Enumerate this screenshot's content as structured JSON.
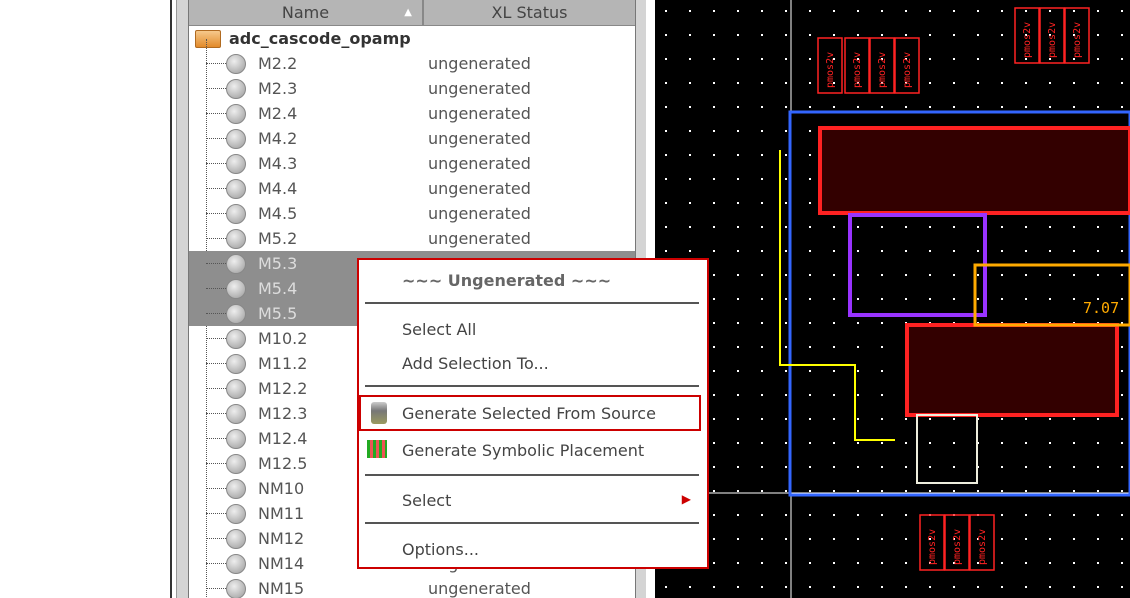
{
  "tree": {
    "columns": {
      "name": "Name",
      "status": "XL Status"
    },
    "root": "adc_cascode_opamp",
    "rows": [
      {
        "name": "M2.2",
        "status": "ungenerated",
        "selected": false
      },
      {
        "name": "M2.3",
        "status": "ungenerated",
        "selected": false
      },
      {
        "name": "M2.4",
        "status": "ungenerated",
        "selected": false
      },
      {
        "name": "M4.2",
        "status": "ungenerated",
        "selected": false
      },
      {
        "name": "M4.3",
        "status": "ungenerated",
        "selected": false
      },
      {
        "name": "M4.4",
        "status": "ungenerated",
        "selected": false
      },
      {
        "name": "M4.5",
        "status": "ungenerated",
        "selected": false
      },
      {
        "name": "M5.2",
        "status": "ungenerated",
        "selected": false
      },
      {
        "name": "M5.3",
        "status": "",
        "selected": true
      },
      {
        "name": "M5.4",
        "status": "",
        "selected": true
      },
      {
        "name": "M5.5",
        "status": "",
        "selected": true
      },
      {
        "name": "M10.2",
        "status": "",
        "selected": false
      },
      {
        "name": "M11.2",
        "status": "",
        "selected": false
      },
      {
        "name": "M12.2",
        "status": "",
        "selected": false
      },
      {
        "name": "M12.3",
        "status": "",
        "selected": false
      },
      {
        "name": "M12.4",
        "status": "",
        "selected": false
      },
      {
        "name": "M12.5",
        "status": "",
        "selected": false
      },
      {
        "name": "NM10",
        "status": "",
        "selected": false
      },
      {
        "name": "NM11",
        "status": "",
        "selected": false
      },
      {
        "name": "NM12",
        "status": "",
        "selected": false
      },
      {
        "name": "NM14",
        "status": "ungenerated",
        "selected": false
      },
      {
        "name": "NM15",
        "status": "ungenerated",
        "selected": false
      }
    ]
  },
  "menu": {
    "title": "~~~ Ungenerated ~~~",
    "select_all": "Select All",
    "add_selection": "Add Selection To...",
    "generate_source": "Generate Selected From Source",
    "generate_symbolic": "Generate Symbolic Placement",
    "select": "Select",
    "options": "Options..."
  },
  "layout": {
    "labels": [
      "pmos2v",
      "pmos2v",
      "pmos2v",
      "pmos2v",
      "pmos2v",
      "pmos2v",
      "pmos2v",
      "pmos2v",
      "pmos2v",
      "pmos2v"
    ],
    "value": "7.07"
  }
}
